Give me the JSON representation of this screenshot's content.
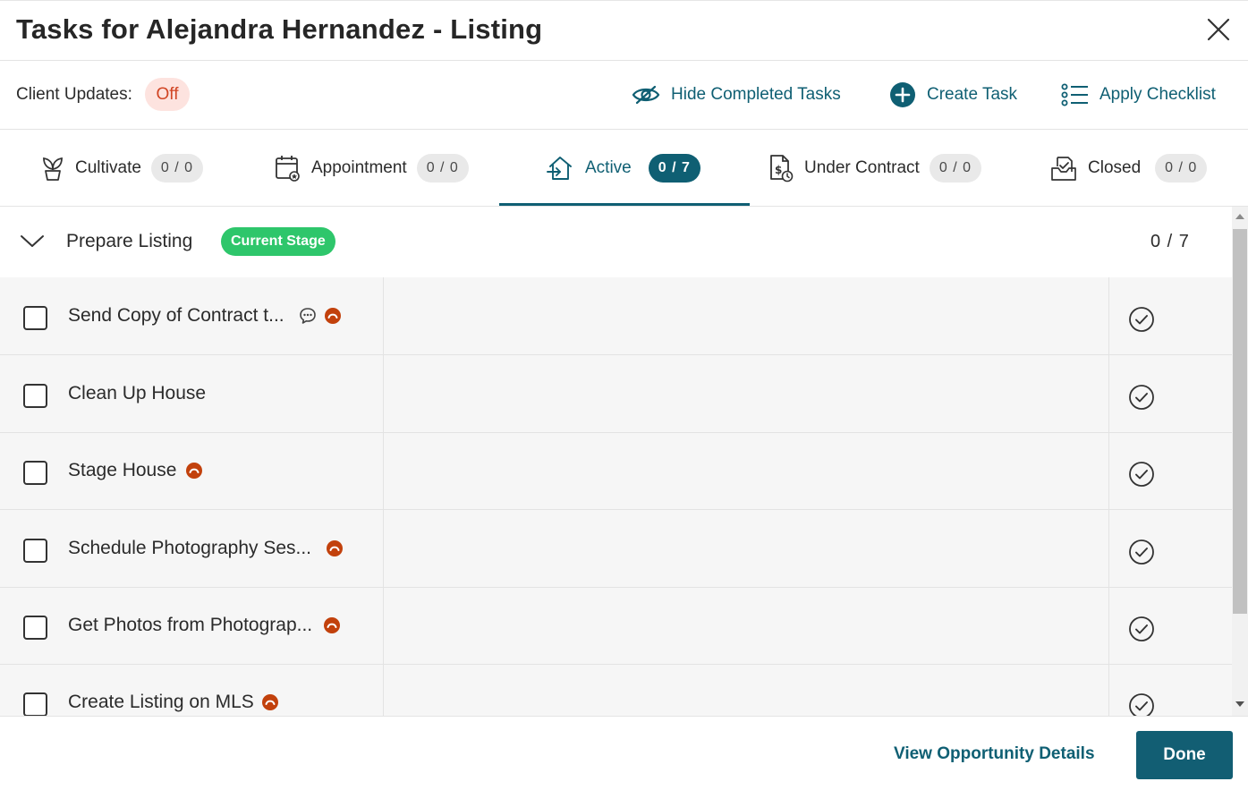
{
  "header": {
    "title": "Tasks for Alejandra Hernandez - Listing",
    "close_icon": "close-icon"
  },
  "toolbar": {
    "client_updates_label": "Client Updates:",
    "client_updates_value": "Off",
    "hide_completed_label": "Hide Completed Tasks",
    "create_task_label": "Create Task",
    "apply_checklist_label": "Apply Checklist"
  },
  "tabs": [
    {
      "label": "Cultivate",
      "count": "0 / 0",
      "icon": "sprout-icon"
    },
    {
      "label": "Appointment",
      "count": "0 / 0",
      "icon": "calendar-icon"
    },
    {
      "label": "Active",
      "count": "0 / 7",
      "icon": "house-arrow-icon",
      "active": true
    },
    {
      "label": "Under Contract",
      "count": "0 / 0",
      "icon": "contract-dollar-icon"
    },
    {
      "label": "Closed",
      "count": "0 / 0",
      "icon": "closed-box-icon"
    }
  ],
  "stage": {
    "name": "Prepare Listing",
    "badge": "Current Stage",
    "count": "0 / 7"
  },
  "tasks": [
    {
      "name": "Send Copy of Contract t...",
      "has_comment": true,
      "has_alert": true
    },
    {
      "name": "Clean Up House",
      "has_comment": false,
      "has_alert": false
    },
    {
      "name": "Stage House",
      "has_comment": false,
      "has_alert": true
    },
    {
      "name": "Schedule Photography Ses...",
      "has_comment": false,
      "has_alert": true
    },
    {
      "name": "Get Photos from Photograp...",
      "has_comment": false,
      "has_alert": true
    },
    {
      "name": "Create Listing on MLS",
      "has_comment": false,
      "has_alert": true
    }
  ],
  "footer": {
    "view_details_label": "View Opportunity Details",
    "done_label": "Done"
  },
  "colors": {
    "accent": "#0f5f73",
    "stage_badge": "#2ec66b",
    "alert": "#c2410c",
    "off_badge_bg": "#fde3df",
    "off_badge_text": "#d14524"
  }
}
